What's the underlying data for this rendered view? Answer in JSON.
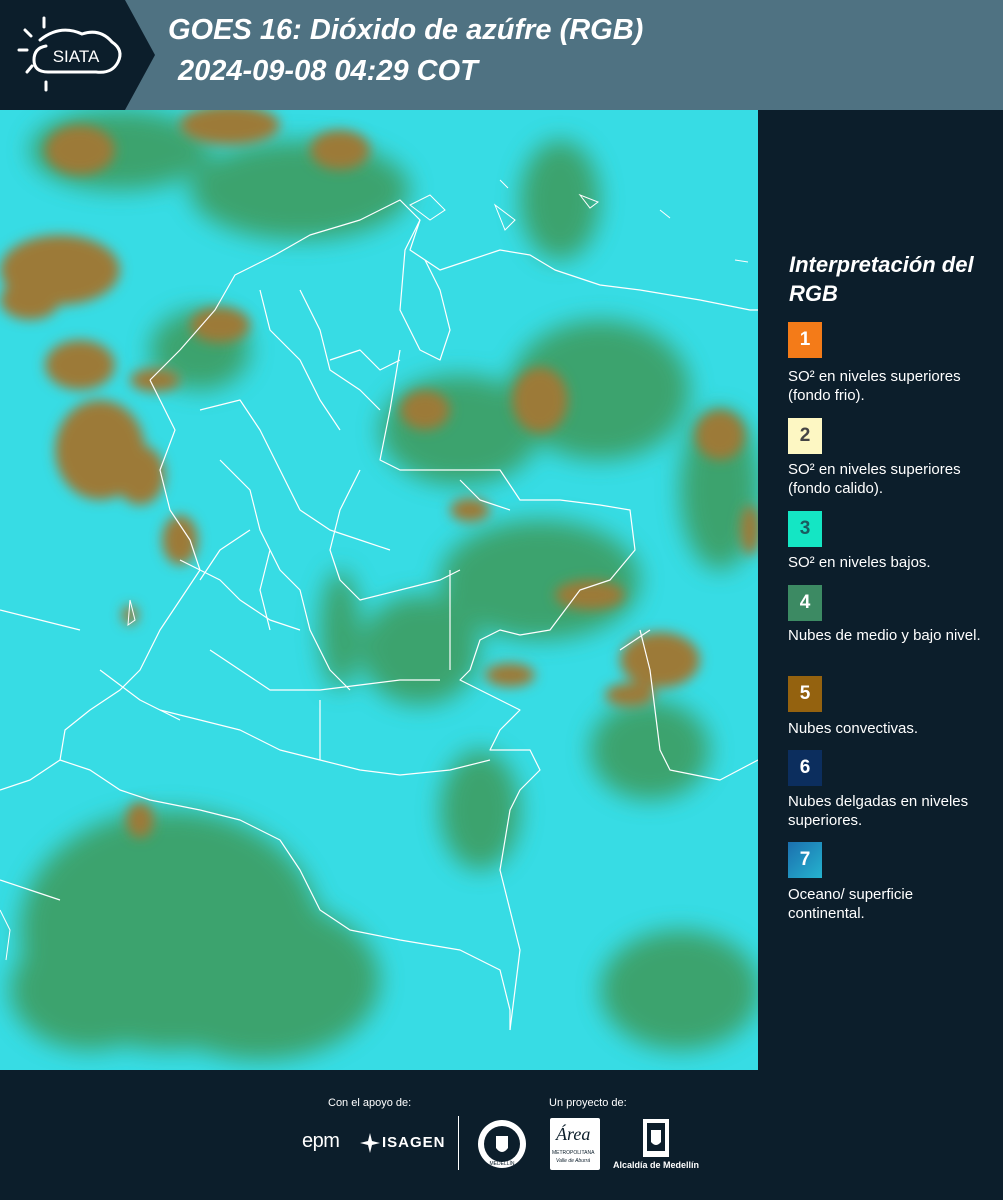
{
  "header": {
    "logo_text": "SIATA",
    "title_line1": "GOES 16: Dióxido de azúfre (RGB)",
    "title_line2": "2024-09-08 04:29 COT"
  },
  "legend": {
    "title": "Interpretación del RGB",
    "items": [
      {
        "number": "1",
        "color": "#f47b18",
        "text": "SO² en niveles superiores (fondo frio)."
      },
      {
        "number": "2",
        "color": "#fdf7c3",
        "text": "SO² en niveles superiores (fondo calido)."
      },
      {
        "number": "3",
        "color": "#14e6c4",
        "text": "SO² en niveles bajos."
      },
      {
        "number": "4",
        "color": "#3c8a63",
        "text": "Nubes de medio y bajo nivel."
      },
      {
        "number": "5",
        "color": "#94620f",
        "text": "Nubes convectivas."
      },
      {
        "number": "6",
        "color": "#0c2e5e",
        "text": "Nubes delgadas en niveles superiores."
      },
      {
        "number": "7",
        "color": "#1a8fbd",
        "text": "Oceano/ superficie continental."
      }
    ]
  },
  "footer": {
    "support_label": "Con el apoyo de:",
    "project_label": "Un proyecto de:",
    "sponsor1": "epm",
    "sponsor2": "ISAGEN",
    "partner_area": "Área",
    "partner_area_sub1": "METROPOLITANA",
    "partner_area_sub2": "Valle de Aburrá",
    "partner_alcaldia": "Alcaldía de Medellín",
    "seal_text": "MEDELLÍN"
  },
  "map_colors": {
    "background": "#2ad8e0",
    "cloud_low": "#3c9a5a",
    "cloud_convective": "#9c7a38",
    "border": "#ffffff"
  }
}
